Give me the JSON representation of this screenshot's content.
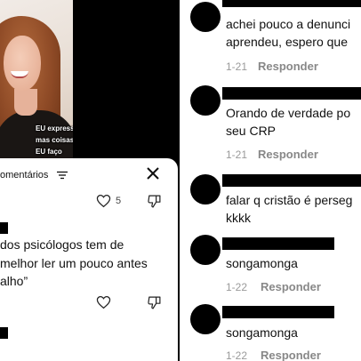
{
  "video": {
    "caption_lines": [
      "EU expressei",
      "mas coisas que",
      "EU faço"
    ]
  },
  "sheet": {
    "title": "omentários",
    "filter_icon": "filter-icon",
    "close_icon": "close-icon",
    "likes": "5",
    "comment_lines": [
      "dos psicólogos tem de",
      "melhor ler um pouco antes",
      "alho”"
    ]
  },
  "thread": [
    {
      "lines": [
        "achei pouco a denunci",
        "aprendeu, espero que"
      ],
      "date": "1-21",
      "reply_label": "Responder"
    },
    {
      "lines": [
        "Orando de verdade po",
        "seu CRP"
      ],
      "date": "1-21",
      "reply_label": "Responder"
    },
    {
      "lines": [
        "falar q cristão é perseg",
        "kkkk"
      ]
    },
    {
      "lines": [
        "songamonga"
      ],
      "date": "1-22",
      "reply_label": "Responder"
    },
    {
      "lines": [
        "songamonga"
      ],
      "date": "1-22",
      "reply_label": "Responder"
    }
  ],
  "colors": {
    "background": "#000000",
    "sheet": "#ffffff",
    "meta_text": "#9a9a9a"
  }
}
